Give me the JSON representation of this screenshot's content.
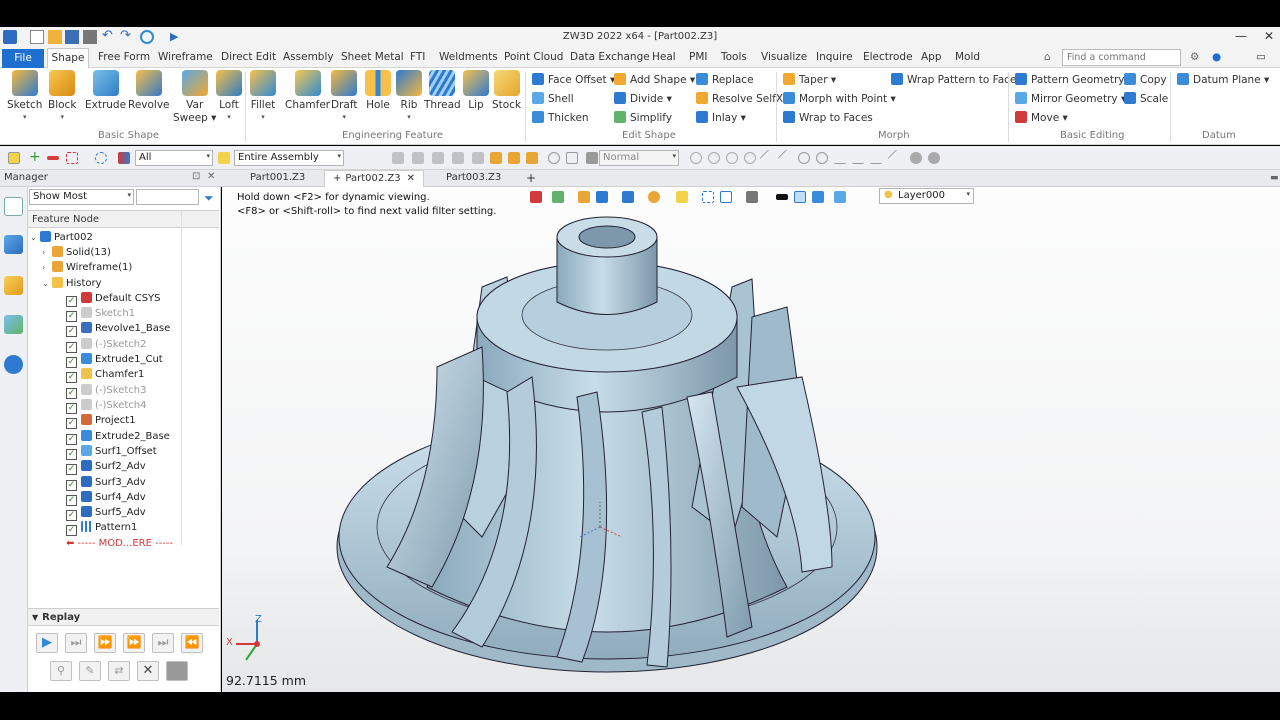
{
  "title": "ZW3D 2022 x64 - [Part002.Z3]",
  "ribbon_tabs": [
    "File",
    "Shape",
    "Free Form",
    "Wireframe",
    "Direct Edit",
    "Assembly",
    "Sheet Metal",
    "FTI",
    "Weldments",
    "Point Cloud",
    "Data Exchange",
    "Heal",
    "PMI",
    "Tools",
    "Visualize",
    "Inquire",
    "Electrode",
    "App",
    "Mold"
  ],
  "search_placeholder": "Find a command",
  "basic_shape": {
    "group": "Basic Shape",
    "items": [
      "Sketch",
      "Block",
      "Extrude",
      "Revolve",
      "Var",
      "Sweep",
      "Loft"
    ]
  },
  "engineering_feature": {
    "group": "Engineering Feature",
    "items": [
      "Fillet",
      "Chamfer",
      "Draft",
      "Hole",
      "Rib",
      "Thread",
      "Lip",
      "Stock"
    ]
  },
  "edit_shape": {
    "group": "Edit Shape",
    "items": [
      "Face Offset",
      "Add Shape",
      "Replace",
      "Shell",
      "Divide",
      "Resolve SelfX",
      "Thicken",
      "Simplify",
      "Inlay"
    ]
  },
  "morph": {
    "group": "Morph",
    "items": [
      "Taper",
      "Wrap Pattern to Faces",
      "Morph with Point",
      "Wrap to Faces"
    ]
  },
  "basic_editing": {
    "group": "Basic Editing",
    "items": [
      "Pattern Geometry",
      "Copy",
      "Mirror Geometry",
      "Scale",
      "Move"
    ]
  },
  "datum": {
    "group": "Datum",
    "items": [
      "Datum Plane"
    ]
  },
  "filter_combo": "All",
  "assembly_combo": "Entire Assembly",
  "normal_combo": "Normal",
  "manager": {
    "title": "Manager",
    "show_combo": "Show Most",
    "column": "Feature Node",
    "replay": "Replay"
  },
  "tree": [
    {
      "label": "Part002"
    },
    {
      "label": "Solid(13)"
    },
    {
      "label": "Wireframe(1)"
    },
    {
      "label": "History"
    },
    {
      "label": "Default CSYS"
    },
    {
      "label": "Sketch1"
    },
    {
      "label": "Revolve1_Base"
    },
    {
      "label": "(-)Sketch2"
    },
    {
      "label": "Extrude1_Cut"
    },
    {
      "label": "Chamfer1"
    },
    {
      "label": "(-)Sketch3"
    },
    {
      "label": "(-)Sketch4"
    },
    {
      "label": "Project1"
    },
    {
      "label": "Extrude2_Base"
    },
    {
      "label": "Surf1_Offset"
    },
    {
      "label": "Surf2_Adv"
    },
    {
      "label": "Surf3_Adv"
    },
    {
      "label": "Surf4_Adv"
    },
    {
      "label": "Surf5_Adv"
    },
    {
      "label": "Pattern1"
    },
    {
      "label": "----- MOD...ERE -----"
    }
  ],
  "doc_tabs": [
    "Part001.Z3",
    "Part002.Z3",
    "Part003.Z3"
  ],
  "hint": [
    "Hold down <F2> for dynamic viewing.",
    "<F8> or <Shift-roll> to find next valid filter setting."
  ],
  "layer": "Layer000",
  "axes": {
    "x": "X",
    "z": "Z"
  },
  "distance": "92.7115 mm"
}
